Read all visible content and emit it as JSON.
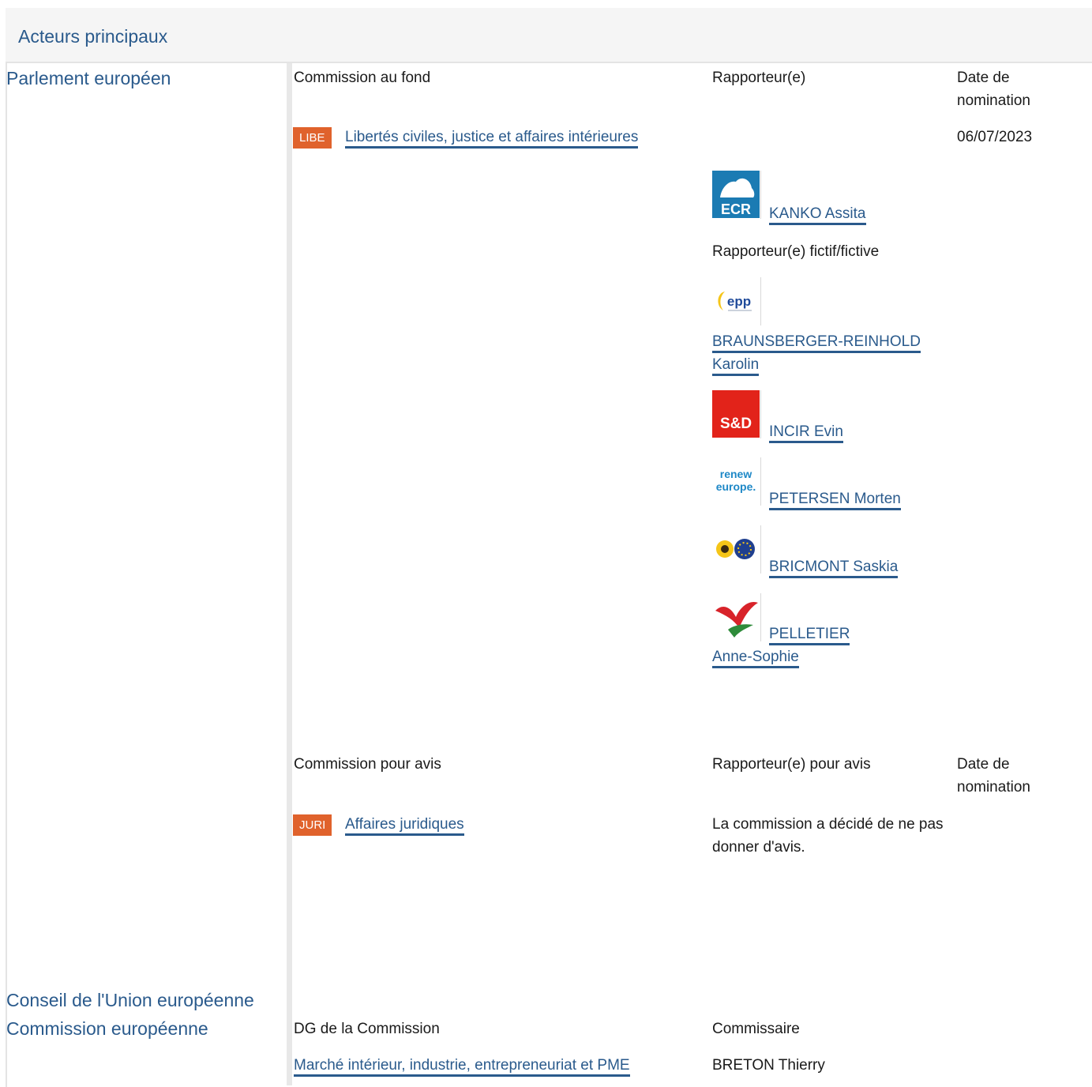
{
  "section": {
    "title": "Acteurs principaux"
  },
  "actors": {
    "parliament": "Parlement européen",
    "council": "Conseil de l'Union européenne",
    "commission": "Commission européenne"
  },
  "lead_committee": {
    "headers": {
      "committee": "Commission au fond",
      "rapporteur": "Rapporteur(e)",
      "date": "Date de nomination"
    },
    "badge": "LIBE",
    "name": "Libertés civiles, justice et affaires intérieures",
    "date": "06/07/2023",
    "rapporteur": {
      "name": "KANKO Assita",
      "group_logo": "ecr-logo"
    },
    "shadow_label": "Rapporteur(e) fictif/fictive",
    "shadows": [
      {
        "name": "BRAUNSBERGER-REINHOLD Karolin",
        "group_logo": "epp-logo"
      },
      {
        "name": "INCIR Evin",
        "group_logo": "sd-logo"
      },
      {
        "name": "PETERSEN Morten",
        "group_logo": "renew-europe-logo"
      },
      {
        "name": "BRICMONT Saskia",
        "group_logo": "greens-efa-logo"
      },
      {
        "name": "PELLETIER Anne-Sophie",
        "group_logo": "gue-ngl-logo"
      }
    ]
  },
  "opinion_committee": {
    "headers": {
      "committee": "Commission pour avis",
      "rapporteur": "Rapporteur(e) pour avis",
      "date": "Date de nomination"
    },
    "badge": "JURI",
    "name": "Affaires juridiques",
    "note": "La commission a décidé de ne pas donner d'avis."
  },
  "commission_dg": {
    "headers": {
      "dg": "DG de la Commission",
      "commissioner": "Commissaire"
    },
    "dg": "Marché intérieur, industrie, entrepreneuriat et PME",
    "commissioner": "BRETON Thierry"
  },
  "logo_text": {
    "ecr": "ECR",
    "epp": "epp",
    "sd": "S&D",
    "renew_1": "renew",
    "renew_2": "europe."
  },
  "colors": {
    "link": "#2a5a8c",
    "badge": "#e0622c",
    "ecr": "#1b7bb3",
    "sd": "#e2231a",
    "epp": "#1f4a9a",
    "renew": "#1e88c7",
    "greens_yellow": "#f5c518",
    "gue_red": "#d8232a",
    "gue_green": "#2e8b3a"
  }
}
